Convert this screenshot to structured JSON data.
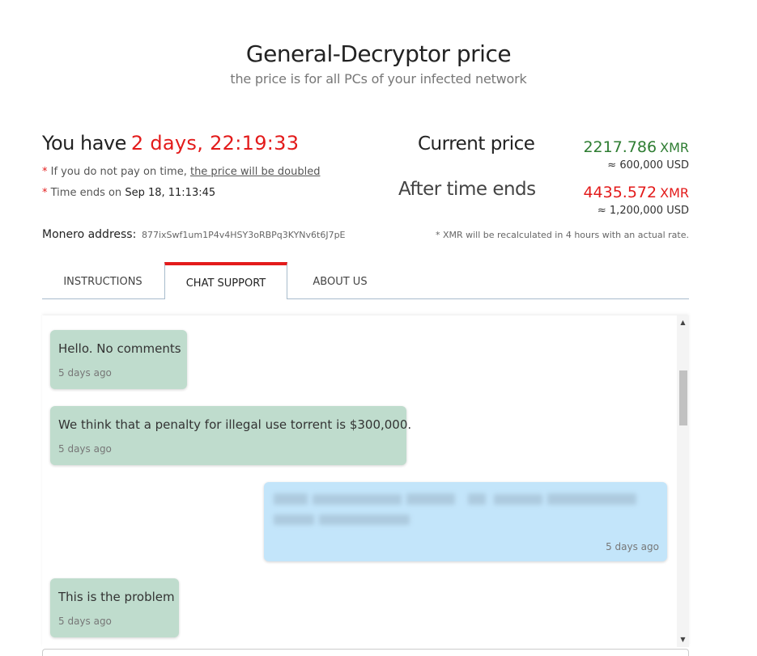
{
  "header": {
    "title": "General-Decryptor price",
    "subtitle": "the price is for all PCs of your infected network"
  },
  "timer": {
    "you_have": "You have",
    "countdown": "2 days, 22:19:33",
    "star": "*",
    "note1_prefix": " If you do not pay on time, ",
    "note1_link": "the price will be doubled",
    "note2_prefix": " Time ends on ",
    "note2_date": "Sep 18, 11:13:45"
  },
  "prices": {
    "current_label": "Current price",
    "current_value": "2217.786",
    "current_unit": "XMR",
    "current_usd": "≈ 600,000 USD",
    "after_label": "After time ends",
    "after_value": "4435.572",
    "after_unit": "XMR",
    "after_usd": "≈ 1,200,000 USD"
  },
  "monero": {
    "label": "Monero address:",
    "address": "877ixSwf1um1P4v4HSY3oRBPq3KYNv6t6J7pE",
    "note": "* XMR will be recalculated in 4 hours with an actual rate."
  },
  "tabs": [
    {
      "label": "INSTRUCTIONS",
      "active": false
    },
    {
      "label": "CHAT SUPPORT",
      "active": true
    },
    {
      "label": "ABOUT US",
      "active": false
    }
  ],
  "chat": {
    "messages": [
      {
        "direction": "incoming",
        "text": "Hello. No comments",
        "time": "5 days ago"
      },
      {
        "direction": "incoming",
        "text": "We think that a penalty for illegal use torrent is $300,000.",
        "time": "5 days ago"
      },
      {
        "direction": "outgoing",
        "text": "",
        "time": "5 days ago",
        "redacted": true
      },
      {
        "direction": "incoming",
        "text": "This is the problem",
        "time": "5 days ago"
      }
    ],
    "scroll_up": "▲",
    "scroll_down": "▼"
  },
  "colors": {
    "accent_red": "#e31b1b",
    "price_green": "#2e7d32",
    "incoming_bubble": "#bfdccd",
    "outgoing_bubble": "#c3e5fa"
  }
}
